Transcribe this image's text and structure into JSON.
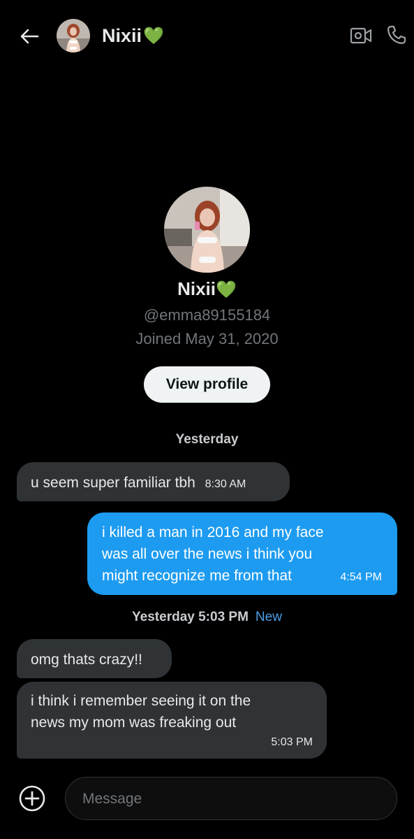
{
  "header": {
    "name": "Nixii",
    "name_emoji": "💚"
  },
  "profile": {
    "name": "Nixii",
    "name_emoji": "💚",
    "handle": "@emma89155184",
    "joined": "Joined May 31, 2020",
    "view_profile_label": "View profile"
  },
  "conversation": {
    "sep1": "Yesterday",
    "msg1": {
      "text": "u seem super familiar tbh",
      "time": "8:30 AM"
    },
    "msg2": {
      "line1": "i killed a man in 2016 and my face",
      "line2": "was all over the news i think you",
      "line3": "might recognize me from that",
      "time": "4:54 PM"
    },
    "sep2": "Yesterday 5:03 PM",
    "sep2_new": "New",
    "msg3": {
      "text": "omg thats crazy!!"
    },
    "msg4": {
      "line1": "i think i remember seeing it on the",
      "line2": "news my mom was freaking out",
      "time": "5:03 PM"
    }
  },
  "composer": {
    "placeholder": "Message"
  },
  "colors": {
    "background": "#000000",
    "incoming_bubble": "#2f3336",
    "outgoing_bubble": "#1d9bf0",
    "new_label": "#4a9ee6",
    "muted_text": "#71767b"
  },
  "icons": {
    "back": "back-arrow-icon",
    "video": "video-camera-icon",
    "call": "phone-icon",
    "add": "add-circle-icon"
  }
}
